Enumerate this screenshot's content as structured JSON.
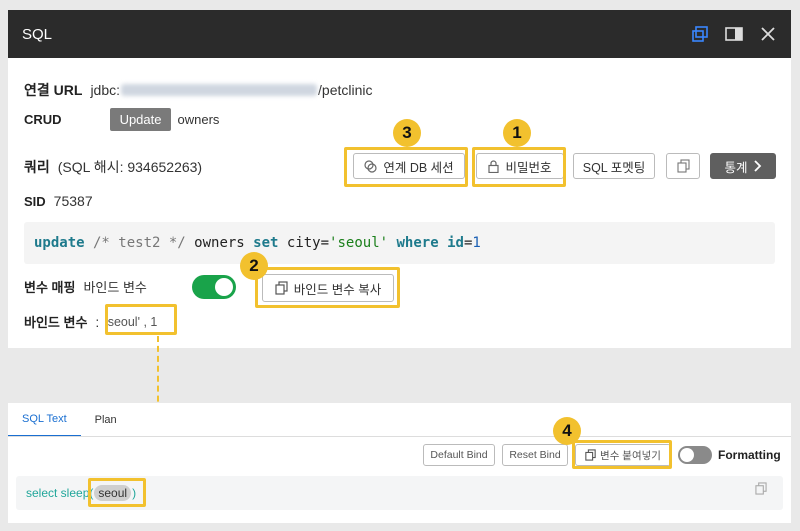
{
  "window": {
    "title": "SQL"
  },
  "conn": {
    "label": "연결 URL",
    "prefix": "jdbc:",
    "suffix": "/petclinic"
  },
  "crud": {
    "label": "CRUD",
    "update_btn": "Update",
    "table": "owners"
  },
  "query": {
    "label": "쿼리",
    "hash": "(SQL 해시: 934652263)"
  },
  "buttons": {
    "linked_db": "연계 DB 세션",
    "password": "비밀번호",
    "sql_format": "SQL 포멧팅",
    "stats": "통계"
  },
  "sid": {
    "label": "SID",
    "value": "75387"
  },
  "code": {
    "t1": "update",
    "t2": " /* test2 */ ",
    "t3": "owners ",
    "t4": "set",
    "t5": " city=",
    "t6": "'seoul'",
    "t7": " ",
    "t8": "where",
    "t9": " ",
    "t10": "id",
    "t11": "=",
    "t12": "1"
  },
  "mapping": {
    "label": "변수 매핑",
    "sub": "바인드 변수",
    "toggle_on": true,
    "copy_btn": "바인드 변수 복사"
  },
  "bind": {
    "label": "바인드 변수",
    "colon": ":",
    "value": "'seoul' , 1"
  },
  "badges": {
    "b1": "1",
    "b2": "2",
    "b3": "3",
    "b4": "4"
  },
  "panel2": {
    "tabs": [
      "SQL Text",
      "Plan"
    ],
    "default_bind": "Default Bind",
    "reset_bind": "Reset Bind",
    "paste_btn": "변수 붙여넣기",
    "formatting": "Formatting",
    "sql_prefix": "select sleep",
    "sql_open": "(",
    "sql_bind": "seoul",
    "sql_close": ")"
  },
  "colors": {
    "highlight": "#f2c12e",
    "toggle_on": "#19a34a",
    "accent": "#1a6fd1"
  }
}
